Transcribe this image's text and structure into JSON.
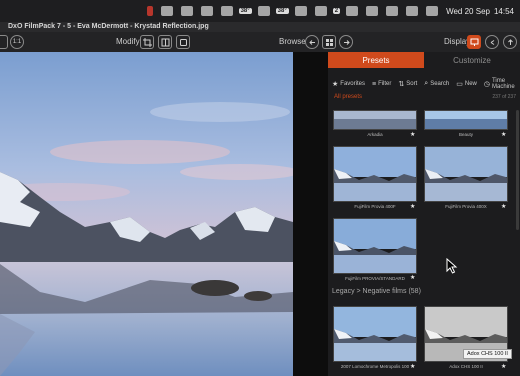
{
  "menubar": {
    "badges": [
      "38°",
      "38°",
      "2"
    ],
    "date": "Wed 20 Sep",
    "time": "14:54"
  },
  "window": {
    "title": "DxO FilmPack 7 - 5 - Eva McDermott - Krystad Reflection.jpg"
  },
  "toolbar": {
    "zoom": "1:1",
    "modify_label": "Modify",
    "browse_label": "Browse",
    "display_label": "Display"
  },
  "panel": {
    "tabs": [
      "Presets",
      "Customize"
    ],
    "filters": [
      {
        "icon": "★",
        "label": "Favorites"
      },
      {
        "icon": "≡",
        "label": "Filter"
      },
      {
        "icon": "⇅",
        "label": "Sort"
      },
      {
        "icon": "⌕",
        "label": "Search"
      },
      {
        "icon": "▭",
        "label": "New"
      },
      {
        "icon": "◷",
        "label": "Time Machine"
      }
    ],
    "all_presets_label": "All presets",
    "count": "237 of 237",
    "thumbnails": [
      {
        "caption": "Arkadia"
      },
      {
        "caption": "Beauty"
      },
      {
        "caption": "FujiFilm Provia 400F"
      },
      {
        "caption": "FujiFilm Provia 400X"
      },
      {
        "caption": "FujiFilm PROVIA/STANDARD"
      },
      {
        "caption": "2007 Lomochrome Metropolis 100"
      },
      {
        "caption": "Adox CHS 100 II"
      }
    ],
    "section_label": "Legacy > Negative films (58)",
    "tooltip": "Adox CHS 100 II"
  },
  "colors": {
    "accent": "#d04a1c",
    "background": "#1c1c1e"
  }
}
